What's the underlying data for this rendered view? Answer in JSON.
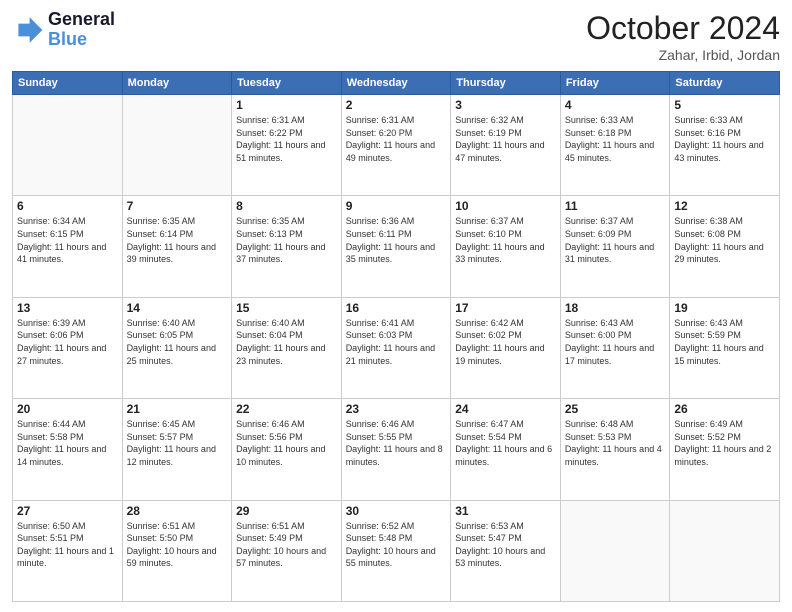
{
  "logo": {
    "line1": "General",
    "line2": "Blue"
  },
  "title": "October 2024",
  "location": "Zahar, Irbid, Jordan",
  "days_of_week": [
    "Sunday",
    "Monday",
    "Tuesday",
    "Wednesday",
    "Thursday",
    "Friday",
    "Saturday"
  ],
  "weeks": [
    [
      {
        "day": "",
        "info": ""
      },
      {
        "day": "",
        "info": ""
      },
      {
        "day": "1",
        "info": "Sunrise: 6:31 AM\nSunset: 6:22 PM\nDaylight: 11 hours and 51 minutes."
      },
      {
        "day": "2",
        "info": "Sunrise: 6:31 AM\nSunset: 6:20 PM\nDaylight: 11 hours and 49 minutes."
      },
      {
        "day": "3",
        "info": "Sunrise: 6:32 AM\nSunset: 6:19 PM\nDaylight: 11 hours and 47 minutes."
      },
      {
        "day": "4",
        "info": "Sunrise: 6:33 AM\nSunset: 6:18 PM\nDaylight: 11 hours and 45 minutes."
      },
      {
        "day": "5",
        "info": "Sunrise: 6:33 AM\nSunset: 6:16 PM\nDaylight: 11 hours and 43 minutes."
      }
    ],
    [
      {
        "day": "6",
        "info": "Sunrise: 6:34 AM\nSunset: 6:15 PM\nDaylight: 11 hours and 41 minutes."
      },
      {
        "day": "7",
        "info": "Sunrise: 6:35 AM\nSunset: 6:14 PM\nDaylight: 11 hours and 39 minutes."
      },
      {
        "day": "8",
        "info": "Sunrise: 6:35 AM\nSunset: 6:13 PM\nDaylight: 11 hours and 37 minutes."
      },
      {
        "day": "9",
        "info": "Sunrise: 6:36 AM\nSunset: 6:11 PM\nDaylight: 11 hours and 35 minutes."
      },
      {
        "day": "10",
        "info": "Sunrise: 6:37 AM\nSunset: 6:10 PM\nDaylight: 11 hours and 33 minutes."
      },
      {
        "day": "11",
        "info": "Sunrise: 6:37 AM\nSunset: 6:09 PM\nDaylight: 11 hours and 31 minutes."
      },
      {
        "day": "12",
        "info": "Sunrise: 6:38 AM\nSunset: 6:08 PM\nDaylight: 11 hours and 29 minutes."
      }
    ],
    [
      {
        "day": "13",
        "info": "Sunrise: 6:39 AM\nSunset: 6:06 PM\nDaylight: 11 hours and 27 minutes."
      },
      {
        "day": "14",
        "info": "Sunrise: 6:40 AM\nSunset: 6:05 PM\nDaylight: 11 hours and 25 minutes."
      },
      {
        "day": "15",
        "info": "Sunrise: 6:40 AM\nSunset: 6:04 PM\nDaylight: 11 hours and 23 minutes."
      },
      {
        "day": "16",
        "info": "Sunrise: 6:41 AM\nSunset: 6:03 PM\nDaylight: 11 hours and 21 minutes."
      },
      {
        "day": "17",
        "info": "Sunrise: 6:42 AM\nSunset: 6:02 PM\nDaylight: 11 hours and 19 minutes."
      },
      {
        "day": "18",
        "info": "Sunrise: 6:43 AM\nSunset: 6:00 PM\nDaylight: 11 hours and 17 minutes."
      },
      {
        "day": "19",
        "info": "Sunrise: 6:43 AM\nSunset: 5:59 PM\nDaylight: 11 hours and 15 minutes."
      }
    ],
    [
      {
        "day": "20",
        "info": "Sunrise: 6:44 AM\nSunset: 5:58 PM\nDaylight: 11 hours and 14 minutes."
      },
      {
        "day": "21",
        "info": "Sunrise: 6:45 AM\nSunset: 5:57 PM\nDaylight: 11 hours and 12 minutes."
      },
      {
        "day": "22",
        "info": "Sunrise: 6:46 AM\nSunset: 5:56 PM\nDaylight: 11 hours and 10 minutes."
      },
      {
        "day": "23",
        "info": "Sunrise: 6:46 AM\nSunset: 5:55 PM\nDaylight: 11 hours and 8 minutes."
      },
      {
        "day": "24",
        "info": "Sunrise: 6:47 AM\nSunset: 5:54 PM\nDaylight: 11 hours and 6 minutes."
      },
      {
        "day": "25",
        "info": "Sunrise: 6:48 AM\nSunset: 5:53 PM\nDaylight: 11 hours and 4 minutes."
      },
      {
        "day": "26",
        "info": "Sunrise: 6:49 AM\nSunset: 5:52 PM\nDaylight: 11 hours and 2 minutes."
      }
    ],
    [
      {
        "day": "27",
        "info": "Sunrise: 6:50 AM\nSunset: 5:51 PM\nDaylight: 11 hours and 1 minute."
      },
      {
        "day": "28",
        "info": "Sunrise: 6:51 AM\nSunset: 5:50 PM\nDaylight: 10 hours and 59 minutes."
      },
      {
        "day": "29",
        "info": "Sunrise: 6:51 AM\nSunset: 5:49 PM\nDaylight: 10 hours and 57 minutes."
      },
      {
        "day": "30",
        "info": "Sunrise: 6:52 AM\nSunset: 5:48 PM\nDaylight: 10 hours and 55 minutes."
      },
      {
        "day": "31",
        "info": "Sunrise: 6:53 AM\nSunset: 5:47 PM\nDaylight: 10 hours and 53 minutes."
      },
      {
        "day": "",
        "info": ""
      },
      {
        "day": "",
        "info": ""
      }
    ]
  ]
}
